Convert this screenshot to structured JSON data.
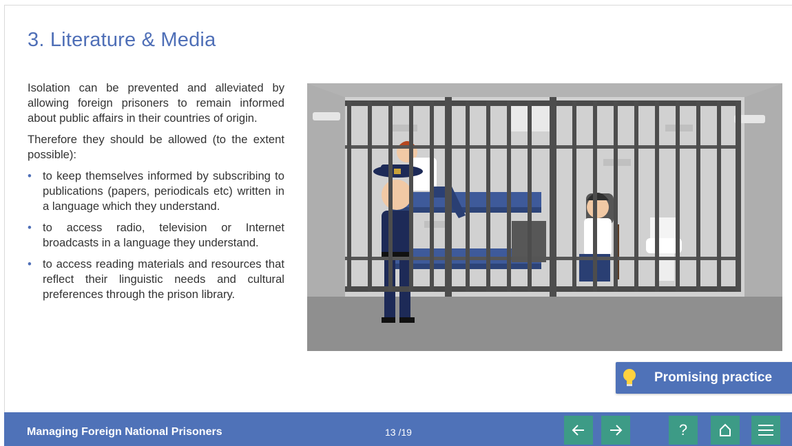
{
  "slide": {
    "title": "3. Literature & Media",
    "intro": "Isolation can be prevented and alleviated by allowing foreign prisoners to remain informed about public affairs in their countries of origin.",
    "therefore": "Therefore they should be allowed (to the extent possible):",
    "bullets": [
      "to keep themselves informed by subscribing to publications (papers, periodicals etc) written in a language which they understand.",
      "to access radio, television or Internet broadcasts in a language they understand.",
      "to access reading materials and resources that reflect their linguistic needs and cultural preferences through the prison library."
    ],
    "bullet_symbol": "•"
  },
  "promising_practice": {
    "label": "Promising practice",
    "icon": "lightbulb-icon"
  },
  "footer": {
    "course_title": "Managing Foreign National Prisoners",
    "page_indicator": "13 /19",
    "buttons": [
      {
        "name": "back-button",
        "icon": "arrow-left-icon"
      },
      {
        "name": "next-button",
        "icon": "arrow-right-icon"
      },
      {
        "name": "help-button",
        "icon": "question-icon",
        "glyph": "?"
      },
      {
        "name": "home-button",
        "icon": "home-icon"
      },
      {
        "name": "menu-button",
        "icon": "hamburger-menu-icon"
      }
    ]
  },
  "colors": {
    "accent_blue": "#4f72b8",
    "title_blue": "#4f6fb7",
    "nav_button_teal": "#3d9b86",
    "body_text": "#333333"
  }
}
